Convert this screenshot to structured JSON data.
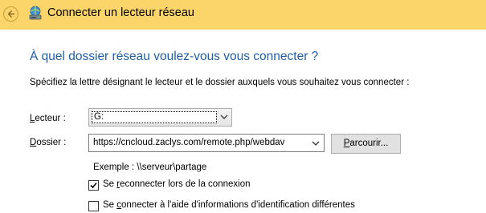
{
  "window": {
    "title": "Connecter un lecteur réseau"
  },
  "dialog": {
    "heading": "À quel dossier réseau voulez-vous vous connecter ?",
    "instruction": "Spécifiez la lettre désignant le lecteur et le dossier auxquels vous souhaitez vous connecter :"
  },
  "drive": {
    "label_before": "",
    "label_accel": "L",
    "label_after": "ecteur :",
    "value": "G:"
  },
  "folder": {
    "label_before": "",
    "label_accel": "D",
    "label_after": "ossier :",
    "value": "https://cncloud.zaclys.com/remote.php/webdav",
    "browse_before": "",
    "browse_accel": "P",
    "browse_after": "arcourir..."
  },
  "example": "Exemple : \\\\serveur\\partage",
  "reconnect": {
    "checked": true,
    "label_before": "Se ",
    "label_accel": "r",
    "label_after": "econnecter lors de la connexion"
  },
  "other_credentials": {
    "checked": false,
    "label_before": "Se ",
    "label_accel": "c",
    "label_after": "onnecter à l'aide d'informations d'identification différentes"
  },
  "icons": {
    "back": "back-arrow-icon",
    "network_drive": "network-drive-icon",
    "dropdown": "chevron-down-icon",
    "check": "checkmark-icon"
  },
  "colors": {
    "title_bar": "#fcd56a",
    "heading": "#1f5fa8"
  }
}
